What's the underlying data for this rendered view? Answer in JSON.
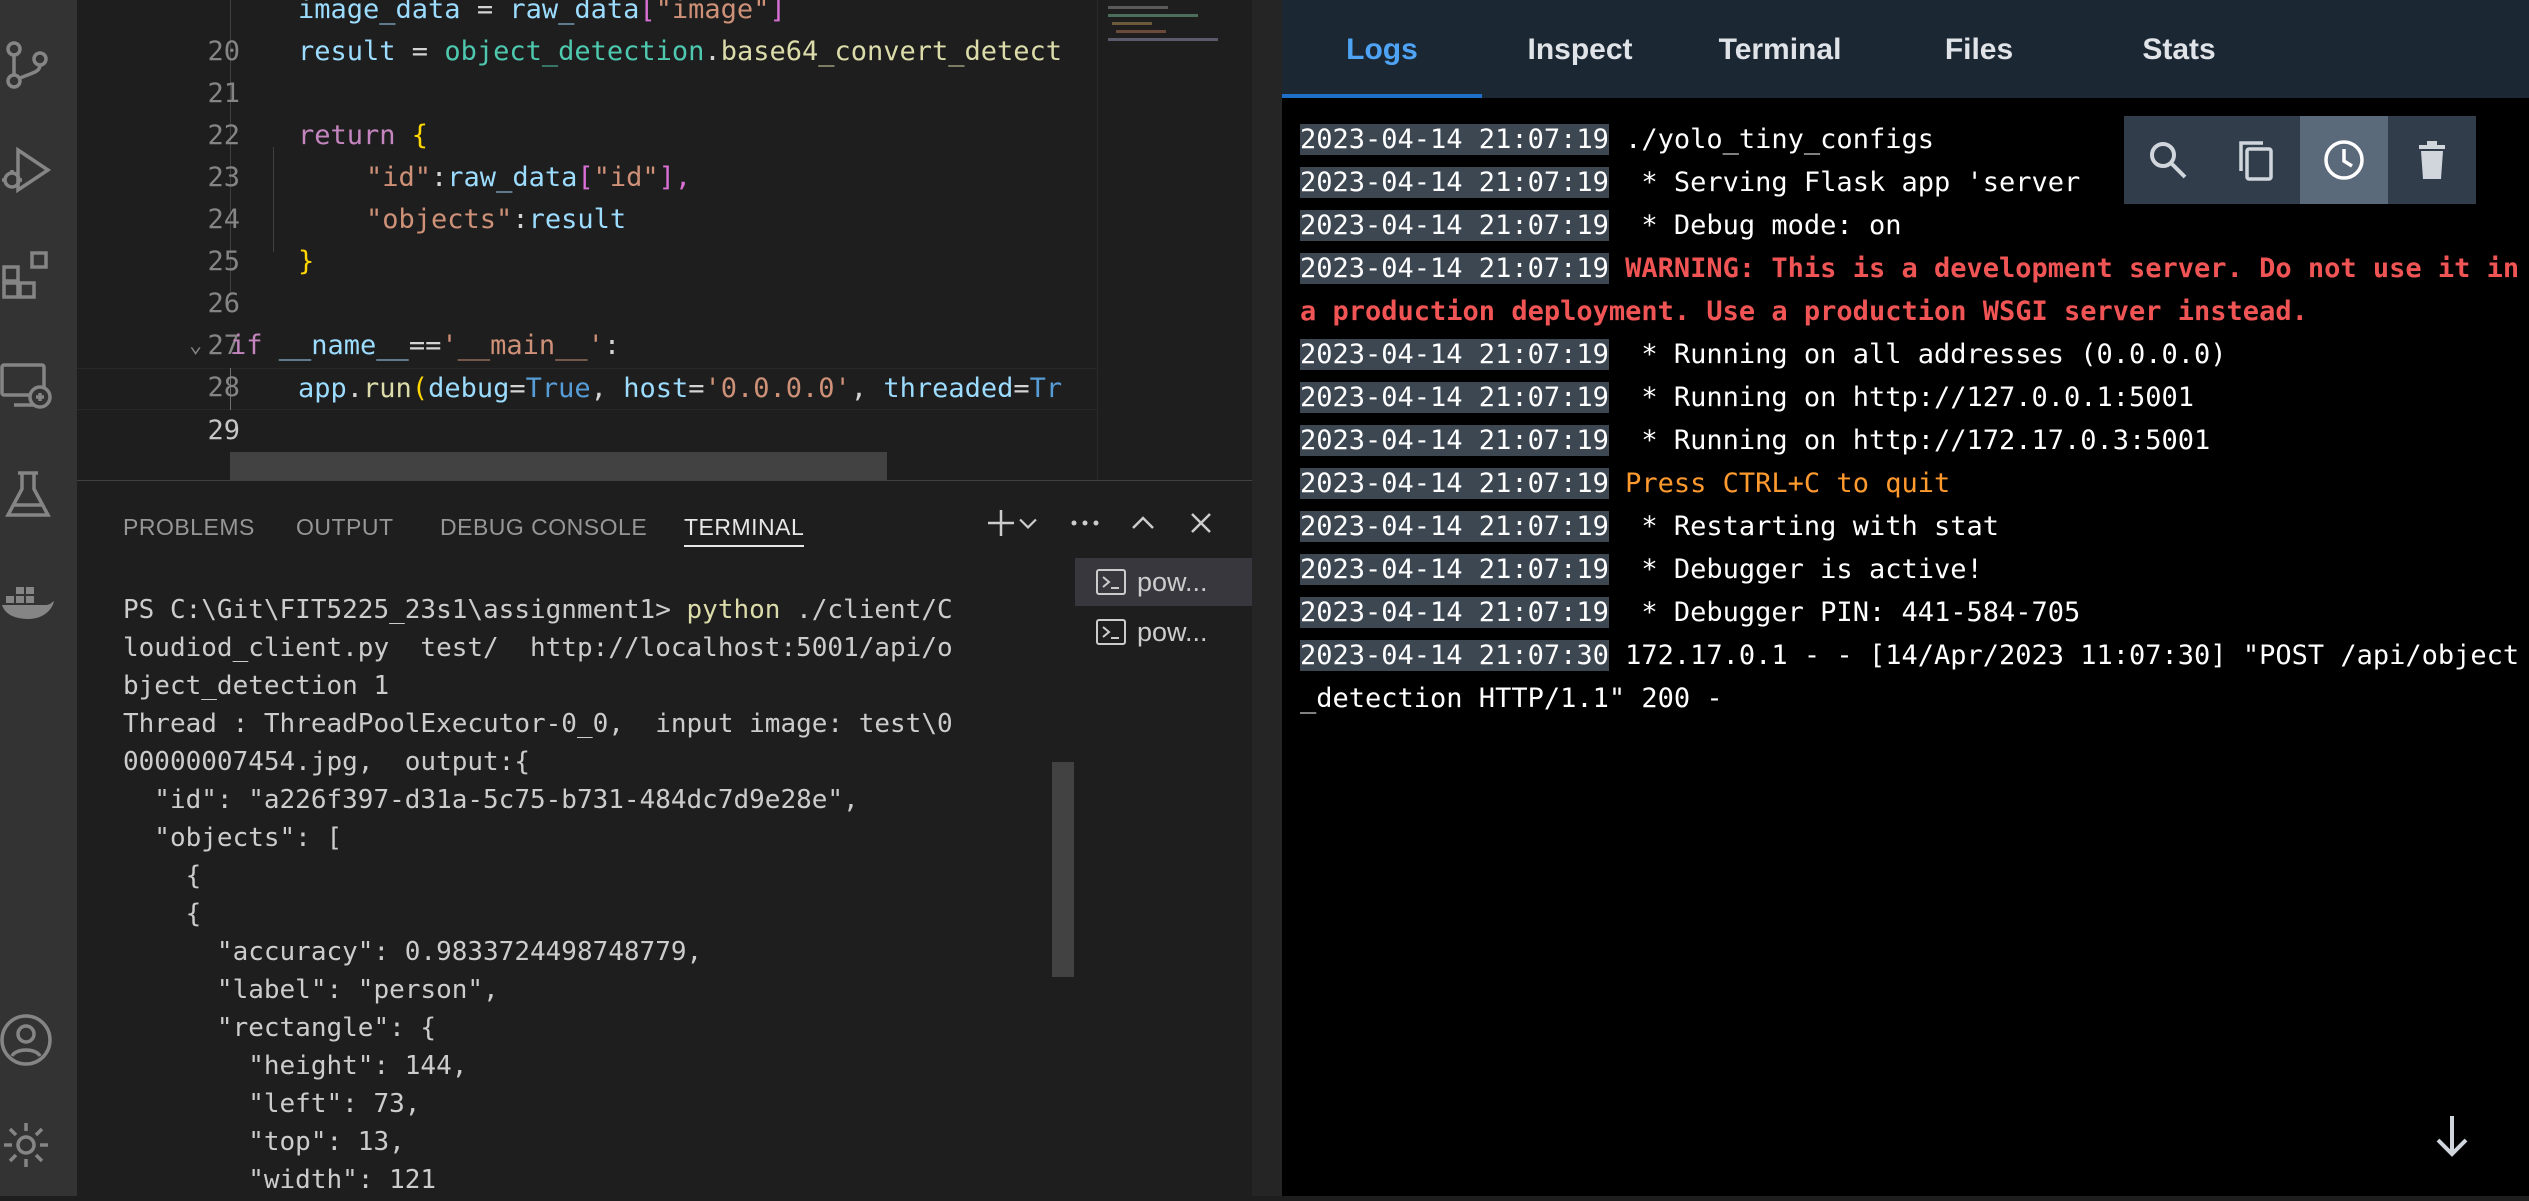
{
  "editor": {
    "lines": [
      {
        "num": "20",
        "indent": 2,
        "parts": [
          [
            "var",
            "image_data"
          ],
          [
            "",
            "&#32;= "
          ],
          [
            "var",
            "raw_data"
          ],
          [
            "brace2",
            "["
          ],
          [
            "str",
            "\"image\""
          ],
          [
            "brace2",
            "]"
          ]
        ]
      },
      {
        "num": "21",
        "indent": 2,
        "parts": [
          [
            "var",
            "result"
          ],
          [
            "",
            ""
          ]
        ]
      },
      {
        "num": "22",
        "indent": 0,
        "parts": []
      },
      {
        "num": "23",
        "indent": 2,
        "parts": []
      },
      {
        "num": "24",
        "indent": 3,
        "parts": []
      },
      {
        "num": "25",
        "indent": 3,
        "parts": []
      },
      {
        "num": "26",
        "indent": 2,
        "parts": []
      },
      {
        "num": "27",
        "indent": 0,
        "parts": []
      },
      {
        "num": "28",
        "indent": 0,
        "parts": []
      },
      {
        "num": "29",
        "indent": 2,
        "parts": []
      }
    ],
    "line_numbers": [
      "20",
      "21",
      "22",
      "23",
      "24",
      "25",
      "26",
      "27",
      "28",
      "29"
    ],
    "text": {
      "l20_a": "image_data",
      "l20_b": " = ",
      "l20_c": "raw_data",
      "l20_d": "[",
      "l20_e": "\"image\"",
      "l20_f": "]",
      "l21_a": "result",
      "l21_b": " = ",
      "l21_c": "object_detection",
      "l21_d": ".",
      "l21_e": "base64_convert_detect",
      "l23_a": "return",
      "l23_b": " {",
      "l24_a": "\"id\"",
      "l24_b": ":",
      "l24_c": "raw_data",
      "l24_d": "[",
      "l24_e": "\"id\"",
      "l24_f": "],",
      "l25_a": "\"objects\"",
      "l25_b": ":",
      "l25_c": "result",
      "l26_a": "}",
      "l28_a": "if",
      "l28_b": " __name__",
      "l28_c": "==",
      "l28_d": "'__main__'",
      "l28_e": ":",
      "l29_a": "app",
      "l29_b": ".",
      "l29_c": "run",
      "l29_d": "(",
      "l29_e": "debug",
      "l29_f": "=",
      "l29_g": "True",
      "l29_h": ", ",
      "l29_i": "host",
      "l29_j": "=",
      "l29_k": "'0.0.0.0'",
      "l29_l": ", ",
      "l29_m": "threaded",
      "l29_n": "=",
      "l29_o": "Tr"
    }
  },
  "panel": {
    "tabs": [
      "PROBLEMS",
      "OUTPUT",
      "DEBUG CONSOLE",
      "TERMINAL"
    ],
    "active_tab": "TERMINAL",
    "terminal_lines": [
      "PS C:\\Git\\FIT5225_23s1\\assignment1> ",
      "loudiod_client.py  test/  http://localhost:5001/api/o",
      "bject_detection 1",
      "Thread : ThreadPoolExecutor-0_0,  input image: test\\0",
      "00000007454.jpg,  output:{",
      "  \"id\": \"a226f397-d31a-5c75-b731-484dc7d9e28e\",",
      "  \"objects\": [",
      "    {",
      "    {",
      "      \"accuracy\": 0.9833724498748779,",
      "      \"label\": \"person\",",
      "      \"rectangle\": {",
      "        \"height\": 144,",
      "        \"left\": 73,",
      "        \"top\": 13,",
      "        \"width\": 121"
    ],
    "command": "python",
    "command_rest": " ./client/C",
    "terminals": [
      "pow...",
      "pow..."
    ]
  },
  "logs": {
    "tabs": [
      "Logs",
      "Inspect",
      "Terminal",
      "Files",
      "Stats"
    ],
    "active_tab": "Logs",
    "entries": [
      {
        "ts": "2023-04-14 21:07:19",
        "msg": " ./yolo_tiny_configs",
        "style": ""
      },
      {
        "ts": "2023-04-14 21:07:19",
        "msg": "  * Serving Flask app 'server",
        "style": ""
      },
      {
        "ts": "2023-04-14 21:07:19",
        "msg": "  * Debug mode: on",
        "style": ""
      },
      {
        "ts": "2023-04-14 21:07:19",
        "msg": " WARNING: This is a development server. Do not use it in a production deployment. Use a production WSGI server instead.",
        "style": "warn"
      },
      {
        "ts": "2023-04-14 21:07:19",
        "msg": "  * Running on all addresses (0.0.0.0)",
        "style": ""
      },
      {
        "ts": "2023-04-14 21:07:19",
        "msg": "  * Running on http://127.0.0.1:5001",
        "style": ""
      },
      {
        "ts": "2023-04-14 21:07:19",
        "msg": "  * Running on http://172.17.0.3:5001",
        "style": ""
      },
      {
        "ts": "2023-04-14 21:07:19",
        "msg": " Press CTRL+C to quit",
        "style": "orange"
      },
      {
        "ts": "2023-04-14 21:07:19",
        "msg": "  * Restarting with stat",
        "style": ""
      },
      {
        "ts": "2023-04-14 21:07:19",
        "msg": "  * Debugger is active!",
        "style": ""
      },
      {
        "ts": "2023-04-14 21:07:19",
        "msg": "  * Debugger PIN: 441-584-705",
        "style": ""
      },
      {
        "ts": "2023-04-14 21:07:30",
        "msg": " 172.17.0.1 - - [14/Apr/2023 11:07:30] \"POST /api/object_detection HTTP/1.1\" 200 -",
        "style": ""
      }
    ]
  },
  "icons": {
    "activity": [
      "source-control-icon",
      "run-debug-icon",
      "extensions-icon",
      "remote-explorer-icon",
      "testing-icon",
      "docker-icon",
      "account-icon",
      "manage-gear-icon"
    ],
    "toolbar": [
      "search-icon",
      "copy-icon",
      "timestamp-clock-icon",
      "delete-icon"
    ]
  },
  "colors": {
    "accent": "#4fa3f5",
    "warning": "#f05454",
    "orange": "#ff9a2e"
  }
}
